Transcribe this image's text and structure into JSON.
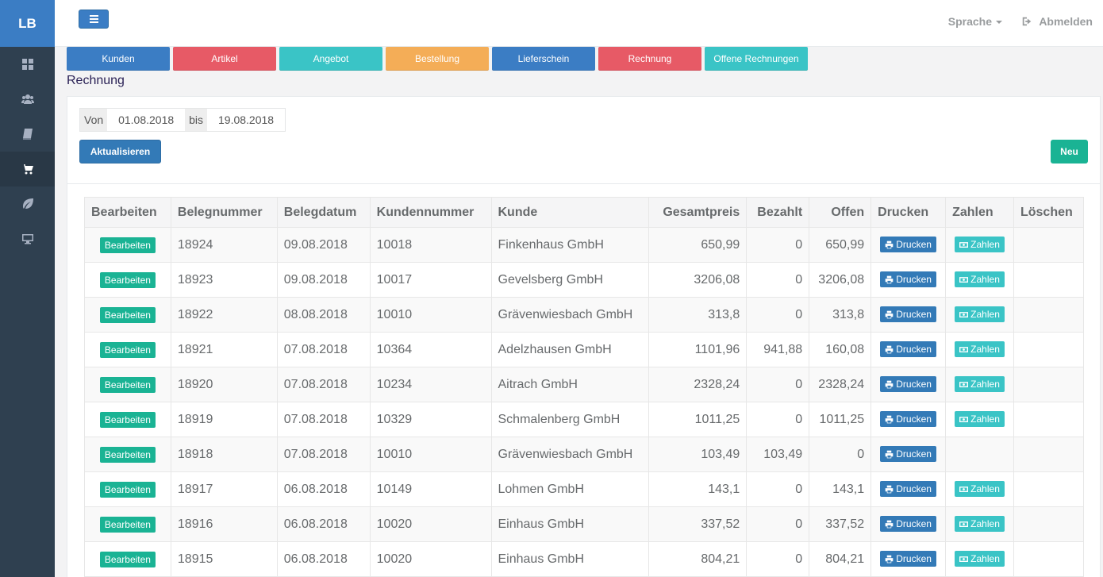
{
  "brand": "LB",
  "sidebar": {
    "items": [
      {
        "icon": "dashboard-icon",
        "active": false
      },
      {
        "icon": "users-icon",
        "active": false
      },
      {
        "icon": "book-icon",
        "active": false
      },
      {
        "icon": "cart-icon",
        "active": true
      },
      {
        "icon": "leaf-icon",
        "active": false
      },
      {
        "icon": "monitor-icon",
        "active": false
      }
    ]
  },
  "topbar": {
    "language_label": "Sprache",
    "logout_label": "Abmelden"
  },
  "modules": [
    {
      "label": "Kunden",
      "color": "#3b7dc4"
    },
    {
      "label": "Artikel",
      "color": "#e75a66"
    },
    {
      "label": "Angebot",
      "color": "#3ac4c6"
    },
    {
      "label": "Bestellung",
      "color": "#f4ad57"
    },
    {
      "label": "Lieferschein",
      "color": "#3b7dc4"
    },
    {
      "label": "Rechnung",
      "color": "#e75a66"
    },
    {
      "label": "Offene Rechnungen",
      "color": "#3ac4c6"
    }
  ],
  "page_title": "Rechnung",
  "filter": {
    "from_label": "Von",
    "from_value": "01.08.2018",
    "to_label": "bis",
    "to_value": "19.08.2018",
    "update_label": "Aktualisieren",
    "new_label": "Neu"
  },
  "table": {
    "columns": [
      "Bearbeiten",
      "Belegnummer",
      "Belegdatum",
      "Kundennummer",
      "Kunde",
      "Gesamtpreis",
      "Bezahlt",
      "Offen",
      "Drucken",
      "Zahlen",
      "Löschen"
    ],
    "edit_label": "Bearbeiten",
    "print_label": "Drucken",
    "pay_label": "Zahlen",
    "rows": [
      {
        "belegnummer": "18924",
        "belegdatum": "09.08.2018",
        "kundennummer": "10018",
        "kunde": "Finkenhaus GmbH",
        "gesamtpreis": "650,99",
        "bezahlt": "0",
        "offen": "650,99",
        "payable": true
      },
      {
        "belegnummer": "18923",
        "belegdatum": "09.08.2018",
        "kundennummer": "10017",
        "kunde": "Gevelsberg GmbH",
        "gesamtpreis": "3206,08",
        "bezahlt": "0",
        "offen": "3206,08",
        "payable": true
      },
      {
        "belegnummer": "18922",
        "belegdatum": "08.08.2018",
        "kundennummer": "10010",
        "kunde": "Grävenwiesbach GmbH",
        "gesamtpreis": "313,8",
        "bezahlt": "0",
        "offen": "313,8",
        "payable": true
      },
      {
        "belegnummer": "18921",
        "belegdatum": "07.08.2018",
        "kundennummer": "10364",
        "kunde": "Adelzhausen GmbH",
        "gesamtpreis": "1101,96",
        "bezahlt": "941,88",
        "offen": "160,08",
        "payable": true
      },
      {
        "belegnummer": "18920",
        "belegdatum": "07.08.2018",
        "kundennummer": "10234",
        "kunde": "Aitrach GmbH",
        "gesamtpreis": "2328,24",
        "bezahlt": "0",
        "offen": "2328,24",
        "payable": true
      },
      {
        "belegnummer": "18919",
        "belegdatum": "07.08.2018",
        "kundennummer": "10329",
        "kunde": "Schmalenberg GmbH",
        "gesamtpreis": "1011,25",
        "bezahlt": "0",
        "offen": "1011,25",
        "payable": true
      },
      {
        "belegnummer": "18918",
        "belegdatum": "07.08.2018",
        "kundennummer": "10010",
        "kunde": "Grävenwiesbach GmbH",
        "gesamtpreis": "103,49",
        "bezahlt": "103,49",
        "offen": "0",
        "payable": false
      },
      {
        "belegnummer": "18917",
        "belegdatum": "06.08.2018",
        "kundennummer": "10149",
        "kunde": "Lohmen GmbH",
        "gesamtpreis": "143,1",
        "bezahlt": "0",
        "offen": "143,1",
        "payable": true
      },
      {
        "belegnummer": "18916",
        "belegdatum": "06.08.2018",
        "kundennummer": "10020",
        "kunde": "Einhaus GmbH",
        "gesamtpreis": "337,52",
        "bezahlt": "0",
        "offen": "337,52",
        "payable": true
      },
      {
        "belegnummer": "18915",
        "belegdatum": "06.08.2018",
        "kundennummer": "10020",
        "kunde": "Einhaus GmbH",
        "gesamtpreis": "804,21",
        "bezahlt": "0",
        "offen": "804,21",
        "payable": true
      }
    ]
  }
}
